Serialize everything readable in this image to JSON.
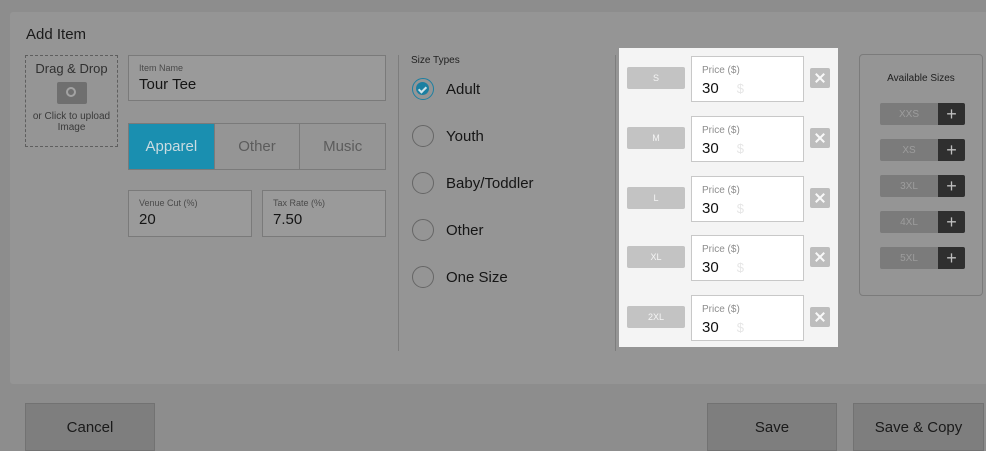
{
  "dialog": {
    "title": "Add Item"
  },
  "image_upload": {
    "label": "Drag & Drop",
    "sublabel": "or Click to upload Image"
  },
  "item_name": {
    "label": "Item Name",
    "value": "Tour Tee"
  },
  "category": {
    "options": [
      "Apparel",
      "Other",
      "Music"
    ],
    "selected": "Apparel"
  },
  "venue_cut": {
    "label": "Venue Cut (%)",
    "value": "20"
  },
  "tax_rate": {
    "label": "Tax Rate (%)",
    "value": "7.50"
  },
  "size_types": {
    "title": "Size Types",
    "options": [
      "Adult",
      "Youth",
      "Baby/Toddler",
      "Other",
      "One Size"
    ],
    "selected": "Adult"
  },
  "sizes": [
    {
      "name": "S",
      "price_label": "Price ($)",
      "price": "30"
    },
    {
      "name": "M",
      "price_label": "Price ($)",
      "price": "30"
    },
    {
      "name": "L",
      "price_label": "Price ($)",
      "price": "30"
    },
    {
      "name": "XL",
      "price_label": "Price ($)",
      "price": "30"
    },
    {
      "name": "2XL",
      "price_label": "Price ($)",
      "price": "30"
    }
  ],
  "available_sizes": {
    "title": "Available Sizes",
    "items": [
      "XXS",
      "XS",
      "3XL",
      "4XL",
      "5XL"
    ]
  },
  "footer": {
    "cancel": "Cancel",
    "save": "Save",
    "save_copy": "Save & Copy"
  },
  "colors": {
    "accent": "#1a8fb0",
    "panel": "#f4f4f4"
  },
  "icons": {
    "upload": "camera-icon",
    "remove": "close-icon",
    "add": "plus-icon",
    "check": "check-icon"
  }
}
